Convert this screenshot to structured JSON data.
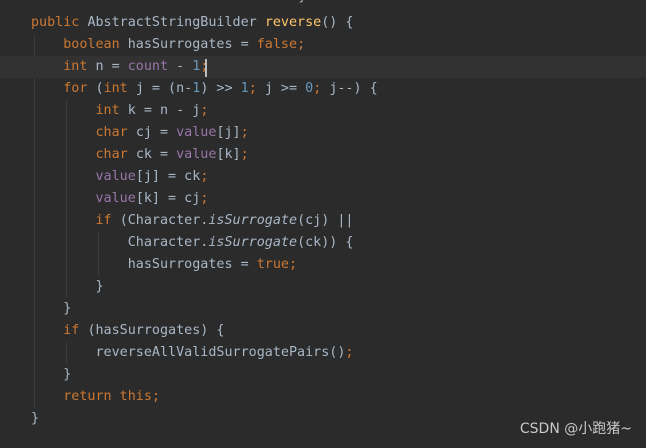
{
  "editor": {
    "top_fragment": "                                     }",
    "lines": [
      [
        {
          "t": "public ",
          "c": "kw"
        },
        {
          "t": "AbstractStringBuilder ",
          "c": "plain"
        },
        {
          "t": "reverse",
          "c": "fn"
        },
        {
          "t": "() {",
          "c": "plain"
        }
      ],
      [
        {
          "t": "    boolean ",
          "c": "kw"
        },
        {
          "t": "hasSurrogates = ",
          "c": "plain"
        },
        {
          "t": "false",
          "c": "kw"
        },
        {
          "t": ";",
          "c": "kw"
        }
      ],
      [
        {
          "t": "    int ",
          "c": "kw"
        },
        {
          "t": "n = ",
          "c": "plain"
        },
        {
          "t": "count",
          "c": "fld"
        },
        {
          "t": " - ",
          "c": "plain"
        },
        {
          "t": "1",
          "c": "num"
        },
        {
          "t": ";",
          "c": "kw"
        }
      ],
      [
        {
          "t": "    for ",
          "c": "kw"
        },
        {
          "t": "(",
          "c": "plain"
        },
        {
          "t": "int ",
          "c": "kw"
        },
        {
          "t": "j = (n-",
          "c": "plain"
        },
        {
          "t": "1",
          "c": "num"
        },
        {
          "t": ") >> ",
          "c": "plain"
        },
        {
          "t": "1",
          "c": "num"
        },
        {
          "t": "; ",
          "c": "kw"
        },
        {
          "t": "j >= ",
          "c": "plain"
        },
        {
          "t": "0",
          "c": "num"
        },
        {
          "t": "; ",
          "c": "kw"
        },
        {
          "t": "j--) {",
          "c": "plain"
        }
      ],
      [
        {
          "t": "        int ",
          "c": "kw"
        },
        {
          "t": "k = n - j",
          "c": "plain"
        },
        {
          "t": ";",
          "c": "kw"
        }
      ],
      [
        {
          "t": "        char ",
          "c": "kw"
        },
        {
          "t": "cj = ",
          "c": "plain"
        },
        {
          "t": "value",
          "c": "fld"
        },
        {
          "t": "[j]",
          "c": "plain"
        },
        {
          "t": ";",
          "c": "kw"
        }
      ],
      [
        {
          "t": "        char ",
          "c": "kw"
        },
        {
          "t": "ck = ",
          "c": "plain"
        },
        {
          "t": "value",
          "c": "fld"
        },
        {
          "t": "[k]",
          "c": "plain"
        },
        {
          "t": ";",
          "c": "kw"
        }
      ],
      [
        {
          "t": "        ",
          "c": "plain"
        },
        {
          "t": "value",
          "c": "fld"
        },
        {
          "t": "[j] = ck",
          "c": "plain"
        },
        {
          "t": ";",
          "c": "kw"
        }
      ],
      [
        {
          "t": "        ",
          "c": "plain"
        },
        {
          "t": "value",
          "c": "fld"
        },
        {
          "t": "[k] = cj",
          "c": "plain"
        },
        {
          "t": ";",
          "c": "kw"
        }
      ],
      [
        {
          "t": "        if ",
          "c": "kw"
        },
        {
          "t": "(Character.",
          "c": "plain"
        },
        {
          "t": "isSurrogate",
          "c": "ital"
        },
        {
          "t": "(cj) ||",
          "c": "plain"
        }
      ],
      [
        {
          "t": "            Character.",
          "c": "plain"
        },
        {
          "t": "isSurrogate",
          "c": "ital"
        },
        {
          "t": "(ck)) {",
          "c": "plain"
        }
      ],
      [
        {
          "t": "            hasSurrogates = ",
          "c": "plain"
        },
        {
          "t": "true",
          "c": "kw"
        },
        {
          "t": ";",
          "c": "kw"
        }
      ],
      [
        {
          "t": "        }",
          "c": "plain"
        }
      ],
      [
        {
          "t": "    }",
          "c": "plain"
        }
      ],
      [
        {
          "t": "    if ",
          "c": "kw"
        },
        {
          "t": "(hasSurrogates) {",
          "c": "plain"
        }
      ],
      [
        {
          "t": "        reverseAllValidSurrogatePairs()",
          "c": "plain"
        },
        {
          "t": ";",
          "c": "kw"
        }
      ],
      [
        {
          "t": "    }",
          "c": "plain"
        }
      ],
      [
        {
          "t": "    return this",
          "c": "kw"
        },
        {
          "t": ";",
          "c": "kw"
        }
      ],
      [
        {
          "t": "}",
          "c": "plain"
        }
      ]
    ],
    "current_line": 2
  },
  "watermark": "CSDN @小跑猪~",
  "colors": {
    "background": "#2b2b2b",
    "current_line": "#323232",
    "keyword": "#cc7832",
    "number": "#6897bb",
    "field": "#9876aa",
    "method_decl": "#ffc66d",
    "text": "#a9b7c6"
  }
}
